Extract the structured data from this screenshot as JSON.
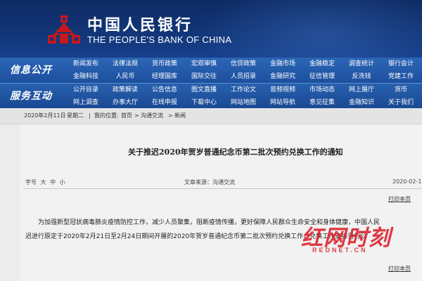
{
  "header": {
    "title_cn": "中国人民银行",
    "title_en": "THE PEOPLE'S BANK OF CHINA",
    "logo_icon": "pboc-logo-icon",
    "brand_red": "#c8161d",
    "banner_color": "#123679"
  },
  "nav": {
    "info": {
      "label": "信息公开",
      "row1": [
        "新闻发布",
        "法律法规",
        "货币政策",
        "宏观审慎",
        "信贷政策",
        "金融市场",
        "金融稳定",
        "调查统计",
        "银行会计"
      ],
      "row2": [
        "金融科技",
        "人民币",
        "经理国库",
        "国际交往",
        "人员招录",
        "金融研究",
        "征信管理",
        "反洗钱",
        "党建工作"
      ]
    },
    "service": {
      "label": "服务互动",
      "row1": [
        "公开目录",
        "政策解读",
        "公告信息",
        "图文直播",
        "工作论文",
        "音频视频",
        "市场动态",
        "网上展厅",
        "货币"
      ],
      "row2": [
        "网上调查",
        "办事大厅",
        "在线申报",
        "下载中心",
        "网站地图",
        "网站导航",
        "意见征集",
        "金融知识",
        "关于我们"
      ]
    }
  },
  "breadcrumb": {
    "date": "2020年2月11日",
    "weekday": "星期二",
    "sep": "|",
    "prefix": "我的位置:",
    "items": [
      "首页",
      "沟通交流",
      "新闻"
    ],
    "arrow": ">"
  },
  "article": {
    "title": "关于推迟2020年贺岁普通纪念币第二批次预约兑换工作的通知",
    "font_size_label": "字号",
    "sizes": [
      "大",
      "中",
      "小"
    ],
    "source": "文章来源：沟通交流",
    "date": "2020-02-1",
    "print": "打印本页",
    "para1": "为加强新型冠状病毒肺炎疫情防控工作，减少人员聚集，阻断疫情传播，更好保障人民群众生命安全和身体健康，中国人民",
    "para2": "迟进行原定于2020年2月21日至2月24日期间开展的2020年贺岁普通纪念币第二批次预约兑换工作，兑换工作安排另行公"
  },
  "watermark": {
    "text": "红网时刻",
    "en": "REDNET.CN",
    "color": "#dc1e28"
  }
}
